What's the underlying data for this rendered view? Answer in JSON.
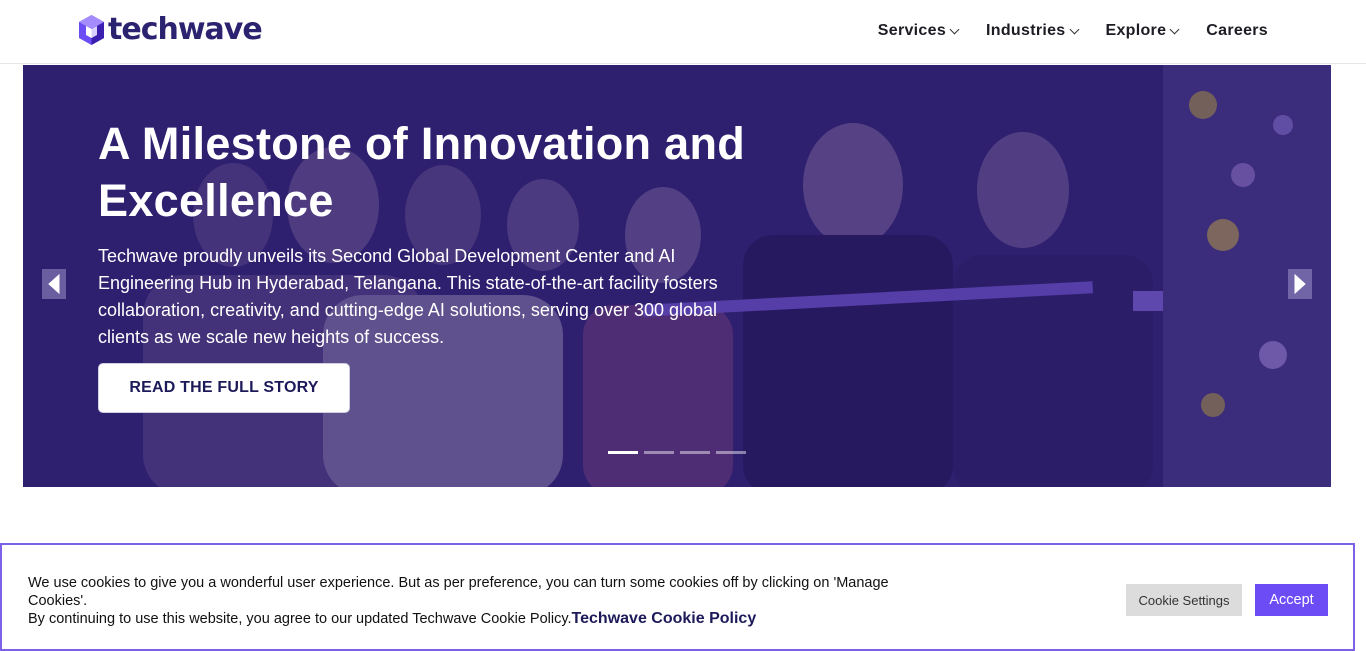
{
  "brand": {
    "logo_text": "techwave",
    "accent": "#6c4cf5",
    "dark": "#1d1a5a"
  },
  "nav": {
    "items": [
      {
        "label": "Services",
        "has_dropdown": true
      },
      {
        "label": "Industries",
        "has_dropdown": true
      },
      {
        "label": "Explore",
        "has_dropdown": true
      },
      {
        "label": "Careers",
        "has_dropdown": false
      }
    ]
  },
  "hero": {
    "title": "A Milestone of Innovation and Excellence",
    "description": "Techwave proudly unveils its Second Global Development Center and AI Engineering Hub in Hyderabad, Telangana. This state-of-the-art facility fosters collaboration, creativity, and cutting-edge AI solutions, serving over 300 global clients as we scale new heights of success.",
    "cta_label": "READ THE FULL STORY",
    "slides_count": 4,
    "active_slide": 1,
    "prev_icon": "chevron-left-icon",
    "next_icon": "chevron-right-icon"
  },
  "cookie": {
    "text_line1": "We use cookies to give you a wonderful user experience. But as per preference, you can turn some cookies off by clicking on 'Manage Cookies'.",
    "text_line2": "By continuing to use this website, you agree to our updated Techwave Cookie Policy.",
    "policy_link": "Techwave Cookie Policy",
    "settings_label": "Cookie Settings",
    "accept_label": "Accept"
  }
}
